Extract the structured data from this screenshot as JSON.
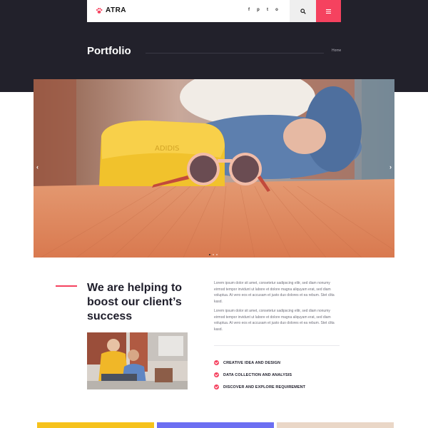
{
  "brand": {
    "name": "ATRA",
    "accent_color": "#f5425f",
    "dark_color": "#22212b"
  },
  "navbar": {
    "socials": [
      "facebook-icon",
      "pinterest-icon",
      "twitter-icon",
      "instagram-icon"
    ],
    "social_glyphs": [
      "f",
      "p",
      "t",
      "o"
    ],
    "search_icon": "search-icon",
    "menu_icon": "hamburger-icon"
  },
  "page_header": {
    "title": "Portfolio",
    "breadcrumb": "Home"
  },
  "slider": {
    "prev_glyph": "‹",
    "next_glyph": "›",
    "slides": 3,
    "active_slide": 1,
    "image": "sunglasses-on-wooden-table-photo"
  },
  "about": {
    "headline": [
      "We are helping to",
      "boost our client’s",
      "success"
    ],
    "paragraphs": [
      "Lorem ipsum dolor sit amet, consetetur sadipscing elitr, sed diam nonumy eirmod tempor invidunt ut labore et dolore magna aliquyam erat, sed diam voluptua. At vero eos et accusam et justo duo dolores et ea rebum. Stet clita kasd.",
      "Lorem ipsum dolor sit amet, consetetur sadipscing elitr, sed diam nonumy eirmod tempor invidunt ut labore et dolore magna aliquyam erat, sed diam voluptua. At vero eos et accusam et justo duo dolores et ea rebum. Stet clita kasd."
    ],
    "features": [
      "CREATIVE IDEA AND DESIGN",
      "DATA COLLECTION AND ANALYSIS",
      "DISCOVER AND EXPLORE REQUIREMENT"
    ],
    "photo": "team-meeting-photo"
  },
  "cards": [
    {
      "color": "#f6c21c"
    },
    {
      "color": "#6c6ff2"
    },
    {
      "color": "#ead7c7"
    }
  ]
}
